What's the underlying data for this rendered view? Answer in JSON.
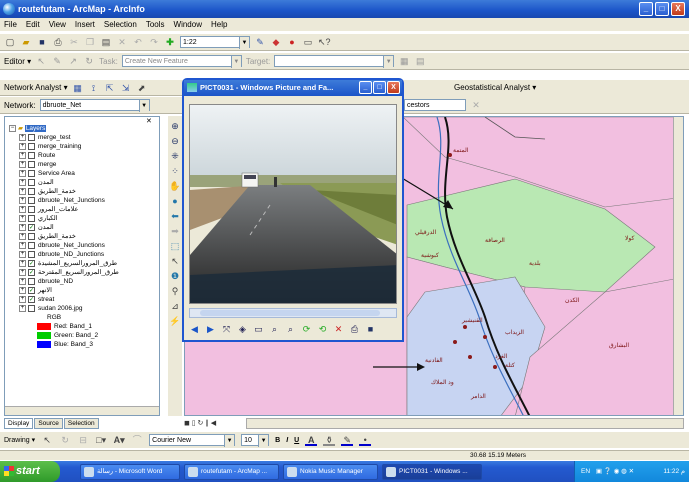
{
  "window": {
    "title": "routefutam - ArcMap - ArcInfo",
    "buttons": [
      "_",
      "□",
      "X"
    ]
  },
  "menu": [
    "File",
    "Edit",
    "View",
    "Insert",
    "Selection",
    "Tools",
    "Window",
    "Help"
  ],
  "standard_toolbar": {
    "scale": "1:22"
  },
  "editor_toolbar": {
    "editor_label": "Editor ▾",
    "task_label": "Task:",
    "task_value": "Create New Feature",
    "target_label": "Target:"
  },
  "network_toolbar": {
    "label": "Network Analyst ▾",
    "network_label": "Network:",
    "network_value": "dbruote_Net",
    "tail_text": "cestors",
    "geostat_label": "Geostatistical Analyst ▾"
  },
  "toc": {
    "root": "Layers",
    "layers": [
      {
        "name": "merge_test",
        "checked": false
      },
      {
        "name": "merge_training",
        "checked": false
      },
      {
        "name": "Route",
        "checked": false
      },
      {
        "name": "merge",
        "checked": false
      },
      {
        "name": "Service Area",
        "checked": false
      },
      {
        "name": "المدن",
        "checked": false
      },
      {
        "name": "خدمة_الطريق",
        "checked": false
      },
      {
        "name": "dbruote_Net_Junctions",
        "checked": false
      },
      {
        "name": "علامات_المرور",
        "checked": false
      },
      {
        "name": "الكباري",
        "checked": false
      },
      {
        "name": "المدن",
        "checked": true
      },
      {
        "name": "خدمة_الطريق",
        "checked": false
      },
      {
        "name": "dbruote_Net_Junctions",
        "checked": false
      },
      {
        "name": "dbruote_ND_Junctions",
        "checked": false
      },
      {
        "name": "طرق_المرورالسريع_المشيدة",
        "checked": true
      },
      {
        "name": "طرق_المرورالسريع_المقترحة",
        "checked": true
      },
      {
        "name": "dbruote_ND",
        "checked": false
      },
      {
        "name": "الانهر",
        "checked": true
      },
      {
        "name": "streat",
        "checked": true
      },
      {
        "name": "sudan 2006.jpg",
        "checked": false
      }
    ],
    "raster": {
      "rgb_label": "RGB",
      "red": "Red:   Band_1",
      "green": "Green: Band_2",
      "blue": "Blue:   Band_3"
    },
    "colors": {
      "red": "#ff0000",
      "green": "#00cc00",
      "blue": "#0000ff"
    }
  },
  "toc_tabs": [
    "Display",
    "Source",
    "Selection"
  ],
  "drawing_toolbar": {
    "drawing_label": "Drawing ▾",
    "font": "Courier New",
    "size": "10",
    "bold": "B",
    "italic": "I",
    "underline": "U"
  },
  "status": {
    "coords": "30.68  15.19 Meters"
  },
  "taskbar": {
    "start": "start",
    "tasks": [
      "رسالة - Microsoft Word",
      "routefutam - ArcMap ...",
      "Nokia Music Manager",
      "PICT0031 - Windows ..."
    ],
    "tray_lang": "EN",
    "clock": "11:22 م"
  },
  "photo_viewer": {
    "title": "PICT0031 - Windows Picture and Fa...",
    "buttons": [
      "_",
      "□",
      "X"
    ]
  },
  "map": {
    "colors": {
      "pink": "#f2bfe0",
      "green": "#b9e8b3",
      "blue": "#c7d4f2",
      "road": "#111111",
      "river": "#3b6fbf"
    },
    "labels": [
      "المتمة",
      "كولا",
      "الدرقيلي",
      "كبوشية",
      "البشارق",
      "القنيشير",
      "الغرد",
      "الفادنية",
      "ود الملاك",
      "بلدية",
      "الدامر",
      "الزيداب",
      "كتلة",
      "الكدن",
      "الرصافة"
    ]
  }
}
